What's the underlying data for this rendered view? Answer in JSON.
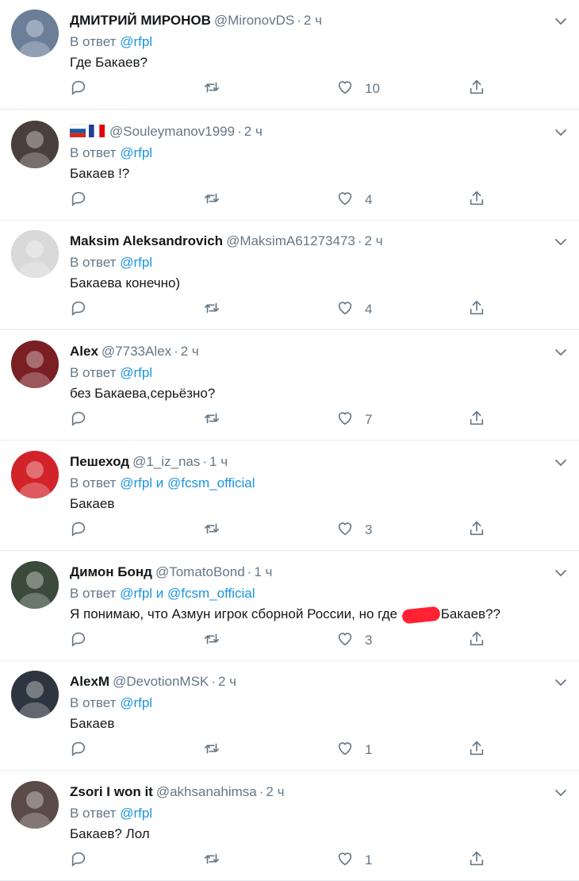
{
  "tweets": [
    {
      "name": "ДМИТРИЙ МИРОНОВ",
      "handle": "@MironovDS",
      "time": "2 ч",
      "reply_prefix": "В ответ",
      "mentions": [
        "@rfpl"
      ],
      "text": "Где Бакаев?",
      "likes": "10",
      "avatar_color": "#6b7f99"
    },
    {
      "name": "",
      "flags": "ru-fr",
      "handle": "@Souleymanov1999",
      "time": "2 ч",
      "reply_prefix": "В ответ",
      "mentions": [
        "@rfpl"
      ],
      "text": "Бакаев !?",
      "likes": "4",
      "avatar_color": "#4a3f3a"
    },
    {
      "name": "Maksim Aleksandrovich",
      "handle": "@MaksimA61273473",
      "time": "2 ч",
      "reply_prefix": "В ответ",
      "mentions": [
        "@rfpl"
      ],
      "text": "Бакаева конечно)",
      "likes": "4",
      "avatar_color": "#d9d9d9"
    },
    {
      "name": "Alex",
      "handle": "@7733Alex",
      "time": "2 ч",
      "reply_prefix": "В ответ",
      "mentions": [
        "@rfpl"
      ],
      "text": "без Бакаева,серьёзно?",
      "likes": "7",
      "avatar_color": "#7a1f24"
    },
    {
      "name": "Пешеход",
      "handle": "@1_iz_nas",
      "time": "1 ч",
      "reply_prefix": "В ответ",
      "mentions": [
        "@rfpl",
        "@fcsm_official"
      ],
      "joiner": "и",
      "text": "Бакаев",
      "likes": "3",
      "avatar_color": "#d2232a"
    },
    {
      "name": "Димон Бонд",
      "handle": "@TomatoBond",
      "time": "1 ч",
      "reply_prefix": "В ответ",
      "mentions": [
        "@rfpl",
        "@fcsm_official"
      ],
      "joiner": "и",
      "text_before": "Я понимаю, что Азмун игрок сборной России, но где",
      "text_after": "Бакаев??",
      "likes": "3",
      "avatar_color": "#3b4a3a"
    },
    {
      "name": "AlexM",
      "handle": "@DevotionMSK",
      "time": "2 ч",
      "reply_prefix": "В ответ",
      "mentions": [
        "@rfpl"
      ],
      "text": "Бакаев",
      "likes": "1",
      "avatar_color": "#2d3640"
    },
    {
      "name": "Zsori I won it",
      "handle": "@akhsanahimsa",
      "time": "2 ч",
      "reply_prefix": "В ответ",
      "mentions": [
        "@rfpl"
      ],
      "text": "Бакаев? Лол",
      "likes": "1",
      "avatar_color": "#5a4a48"
    }
  ],
  "colors": {
    "link": "#1b95e0",
    "muted": "#657786",
    "text": "#14171a",
    "redaction": "#ff2233"
  },
  "icons": {
    "reply": "reply-icon",
    "retweet": "retweet-icon",
    "like": "heart-icon",
    "share": "share-icon",
    "menu": "chevron-down-icon"
  }
}
